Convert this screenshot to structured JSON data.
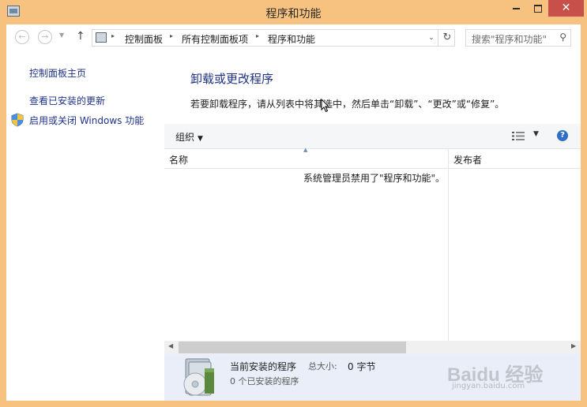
{
  "window": {
    "title": "程序和功能",
    "controls": {
      "close_glyph": "✕"
    }
  },
  "navbar": {
    "back_glyph": "←",
    "forward_glyph": "→",
    "recent_glyph": "▼",
    "up_glyph": "↑",
    "breadcrumbs": [
      "控制面板",
      "所有控制面板项",
      "程序和功能"
    ],
    "crumb_separator": "▸",
    "dropdown_glyph": "⌄",
    "refresh_glyph": "↻",
    "search_placeholder": "搜索\"程序和功能\"",
    "search_glyph": "⚲"
  },
  "sidebar": {
    "items": [
      {
        "label": "控制面板主页"
      },
      {
        "label": "查看已安装的更新"
      },
      {
        "label": "启用或关闭 Windows 功能",
        "icon": "uac-shield-icon"
      }
    ]
  },
  "main": {
    "title": "卸载或更改程序",
    "description": "若要卸载程序，请从列表中将其选中，然后单击“卸载”、“更改”或“修复”。",
    "toolbar": {
      "organize_label": "组织",
      "caret": "▼",
      "views_caret": "▼",
      "help_glyph": "?"
    },
    "columns": {
      "name": "名称",
      "publisher": "发布者",
      "sort_glyph": "▲"
    },
    "empty_message": "系统管理员禁用了\"程序和功能\"。",
    "scrollbar": {
      "left_glyph": "◀",
      "right_glyph": "▶"
    }
  },
  "details": {
    "title": "当前安装的程序",
    "size_label": "总大小:",
    "size_value": "0 字节",
    "count_text": "0 个已安装的程序"
  },
  "watermark": {
    "brand": "Baidu 经验",
    "url": "jingyan.baidu.com"
  },
  "colors": {
    "title_bar": "#f7c27f",
    "close_button": "#c7504a",
    "link": "#1e3287",
    "details_pane": "#e9eef8"
  }
}
